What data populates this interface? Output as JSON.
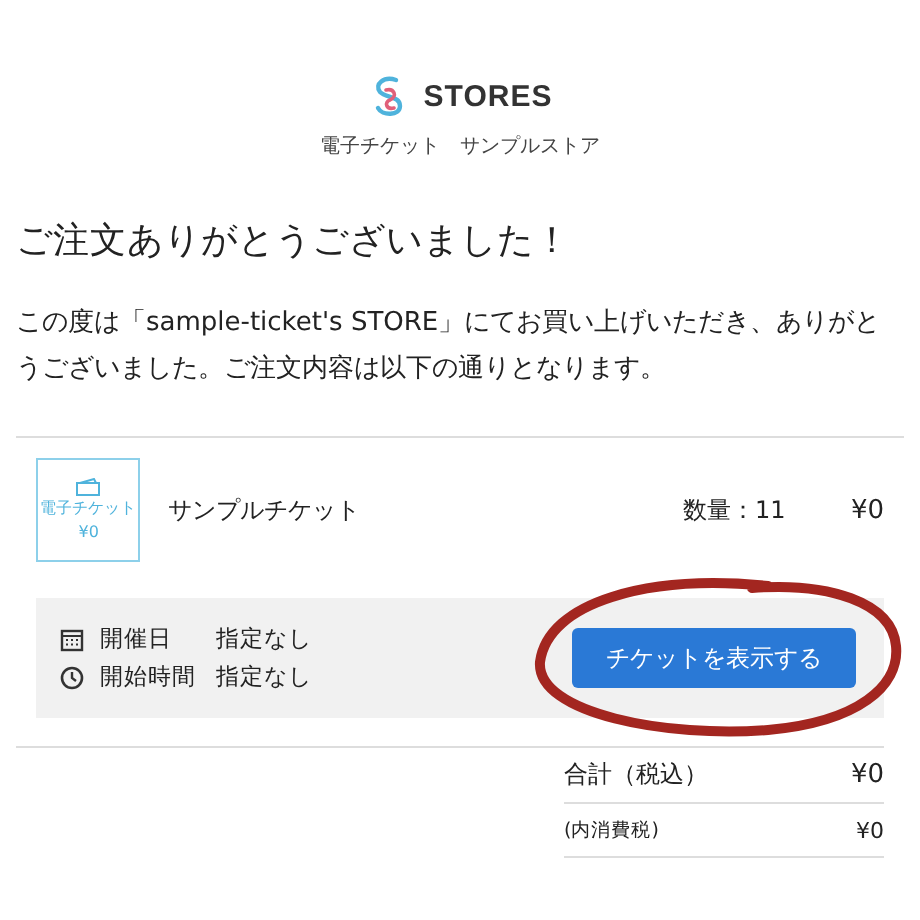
{
  "header": {
    "brand": "STORES",
    "store_name": "電子チケット　サンプルストア"
  },
  "heading": "ご注文ありがとうございました！",
  "message": "この度は「sample-ticket's STORE」にてお買い上げいただき、ありがとうございました。ご注文内容は以下の通りとなります。",
  "item": {
    "thumbnail": {
      "label": "電子チケット",
      "price": "¥0"
    },
    "name": "サンプルチケット",
    "quantity": "数量：11",
    "price": "¥0"
  },
  "details": [
    {
      "kind": "date",
      "label": "開催日",
      "value": "指定なし"
    },
    {
      "kind": "time",
      "label": "開始時間",
      "value": "指定なし"
    }
  ],
  "show_ticket_button": {
    "label": "チケットを表示する",
    "circled": true
  },
  "totals": [
    {
      "kind": "main",
      "label": "合計（税込）",
      "value": "¥0"
    },
    {
      "kind": "sub",
      "label": "(内消費税)",
      "value": "¥0"
    }
  ]
}
